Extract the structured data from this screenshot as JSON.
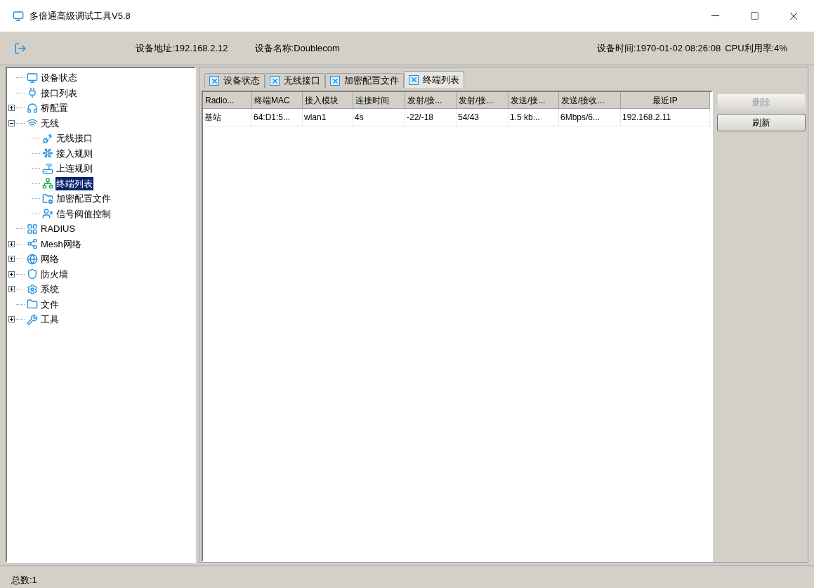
{
  "window": {
    "title": "多倍通高级调试工具V5.8"
  },
  "toolbar": {
    "device_address": "设备地址:192.168.2.12",
    "device_name": "设备名称:Doublecom",
    "device_time": "设备时间:1970-01-02 08:26:08",
    "cpu": "CPU利用率:4%"
  },
  "tree": [
    {
      "label": "设备状态",
      "selected": false
    },
    {
      "label": "接口列表",
      "selected": false
    },
    {
      "label": "桥配置",
      "selected": false,
      "expanded": false
    },
    {
      "label": "无线",
      "selected": false,
      "expanded": true,
      "children": [
        {
          "label": "无线接口",
          "selected": false
        },
        {
          "label": "接入规则",
          "selected": false
        },
        {
          "label": "上连规则",
          "selected": false
        },
        {
          "label": "终端列表",
          "selected": true
        },
        {
          "label": "加密配置文件",
          "selected": false
        },
        {
          "label": "信号阀值控制",
          "selected": false
        }
      ]
    },
    {
      "label": "RADIUS",
      "selected": false
    },
    {
      "label": "Mesh网络",
      "selected": false,
      "expanded": false
    },
    {
      "label": "网络",
      "selected": false,
      "expanded": false
    },
    {
      "label": "防火墙",
      "selected": false,
      "expanded": false
    },
    {
      "label": "系统",
      "selected": false,
      "expanded": false
    },
    {
      "label": "文件",
      "selected": false
    },
    {
      "label": "工具",
      "selected": false,
      "expanded": false
    }
  ],
  "tabs": [
    {
      "label": "设备状态",
      "selected": false
    },
    {
      "label": "无线接口",
      "selected": false
    },
    {
      "label": "加密配置文件",
      "selected": false
    },
    {
      "label": "终端列表",
      "selected": true
    }
  ],
  "table": {
    "columns": [
      "Radio...",
      "终端MAC",
      "接入模块",
      "连接时间",
      "发射/接...",
      "发射/接...",
      "发送/接...",
      "发送/接收...",
      "最近IP"
    ],
    "rows": [
      [
        "基站",
        "64:D1:5...",
        "wlan1",
        "4s",
        "-22/-18",
        "54/43",
        "1.5 kb...",
        "6Mbps/6...",
        "192.168.2.11"
      ]
    ]
  },
  "buttons": [
    {
      "label": "删除",
      "disabled": true
    },
    {
      "label": "刷新",
      "disabled": false
    }
  ],
  "status_bar": {
    "total": "总数:1"
  }
}
